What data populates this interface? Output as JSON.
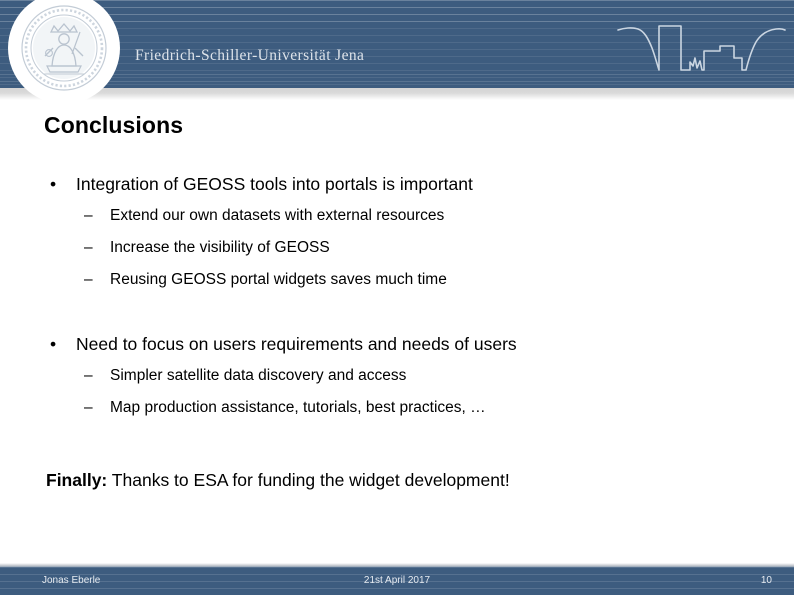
{
  "header": {
    "university_name": "Friedrich-Schiller-Universität Jena",
    "seal_icon": "university-seal-icon",
    "skyline_icon": "jena-skyline-icon",
    "background_color": "#3d5c7f",
    "text_color": "#dde3ea"
  },
  "slide": {
    "title": "Conclusions",
    "blocks": [
      {
        "bullet": "Integration of GEOSS tools into portals is important",
        "bullet_marker": "•",
        "sub_marker": "–",
        "sub_bullets": [
          "Extend our own datasets with external resources",
          "Increase the visibility of GEOSS",
          "Reusing GEOSS portal widgets saves much time"
        ]
      },
      {
        "bullet": "Need to focus on users requirements and needs of users",
        "bullet_marker": "•",
        "sub_marker": "–",
        "sub_bullets": [
          "Simpler satellite data discovery and access",
          "Map production assistance, tutorials, best practices, …"
        ]
      }
    ],
    "closing": {
      "lead": "Finally:",
      "text": " Thanks to ESA for funding the widget development!"
    }
  },
  "footer": {
    "author": "Jonas Eberle",
    "date": "21st April 2017",
    "page_number": "10",
    "background_color": "#3d5c7f",
    "text_color": "#e6ebf1"
  }
}
